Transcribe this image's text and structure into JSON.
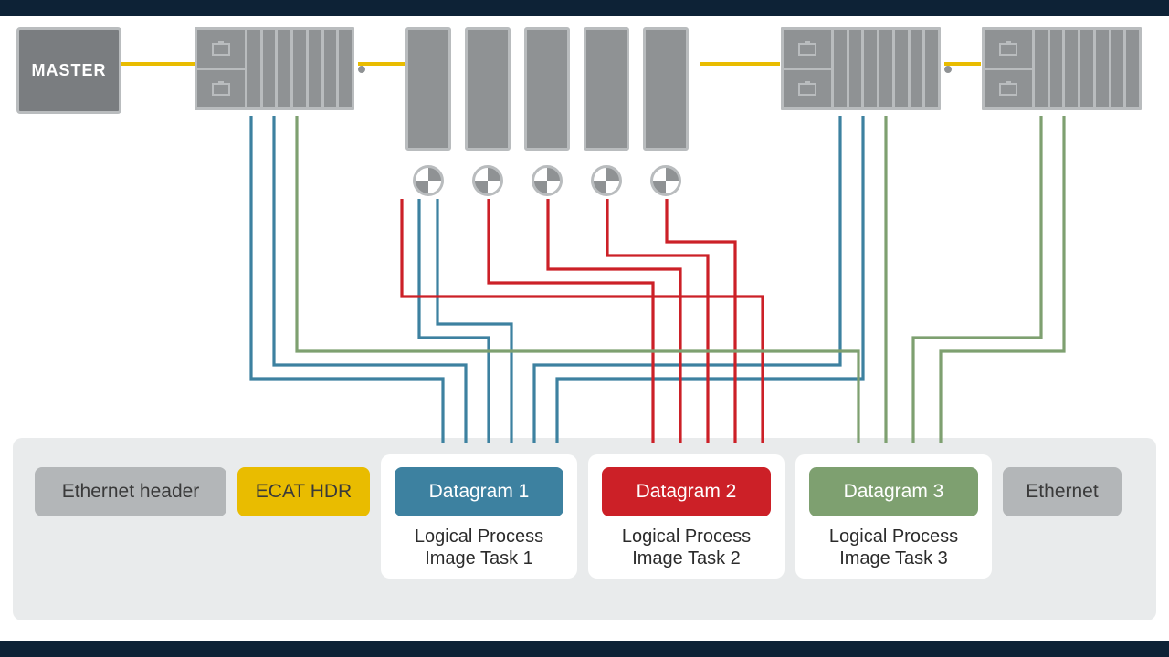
{
  "master_label": "MASTER",
  "packet": {
    "eth_header": "Ethernet header",
    "ecat_hdr": "ECAT HDR",
    "dg1": "Datagram 1",
    "dg2": "Datagram 2",
    "dg3": "Datagram 3",
    "eth_trailer": "Ethernet",
    "sub1": "Logical Process Image Task 1",
    "sub2": "Logical Process Image Task 2",
    "sub3": "Logical Process Image Task 3"
  },
  "colors": {
    "blue": "#3d81a0",
    "red": "#cc2027",
    "green": "#7ea070",
    "yellow": "#e9bc00",
    "grey": "#b3b6b8"
  }
}
